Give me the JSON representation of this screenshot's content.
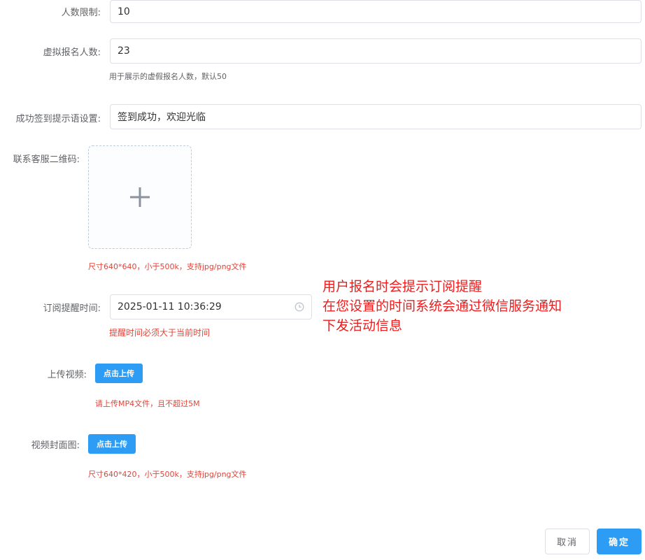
{
  "form": {
    "people_limit": {
      "label": "人数限制:",
      "value": "10"
    },
    "virtual_signup": {
      "label": "虚拟报名人数:",
      "value": "23",
      "hint": "用于展示的虚假报名人数，默认50"
    },
    "checkin_message": {
      "label": "成功签到提示语设置:",
      "value": "签到成功，欢迎光临"
    },
    "qr_code": {
      "label": "联系客服二维码:",
      "icon": "plus-icon",
      "hint": "尺寸640*640，小于500k，支持jpg/png文件"
    },
    "reminder_time": {
      "label": "订阅提醒时间:",
      "value": "2025-01-11 10:36:29",
      "icon": "clock-icon",
      "hint": "提醒时间必须大于当前时间"
    },
    "video_upload": {
      "label": "上传视频:",
      "button": "点击上传",
      "hint": "请上传MP4文件，且不超过5M"
    },
    "video_cover": {
      "label": "视频封面图:",
      "button": "点击上传",
      "hint": "尺寸640*420，小于500k，支持jpg/png文件"
    }
  },
  "annotation": {
    "lines": [
      "用户报名时会提示订阅提醒",
      "在您设置的时间系统会通过微信服务通知",
      "下发活动信息"
    ]
  },
  "footer": {
    "cancel_label": "取消",
    "confirm_label": "确定"
  },
  "colors": {
    "primary": "#2d9cf5",
    "error": "#e0443a",
    "annotation": "#ee1c1c"
  }
}
